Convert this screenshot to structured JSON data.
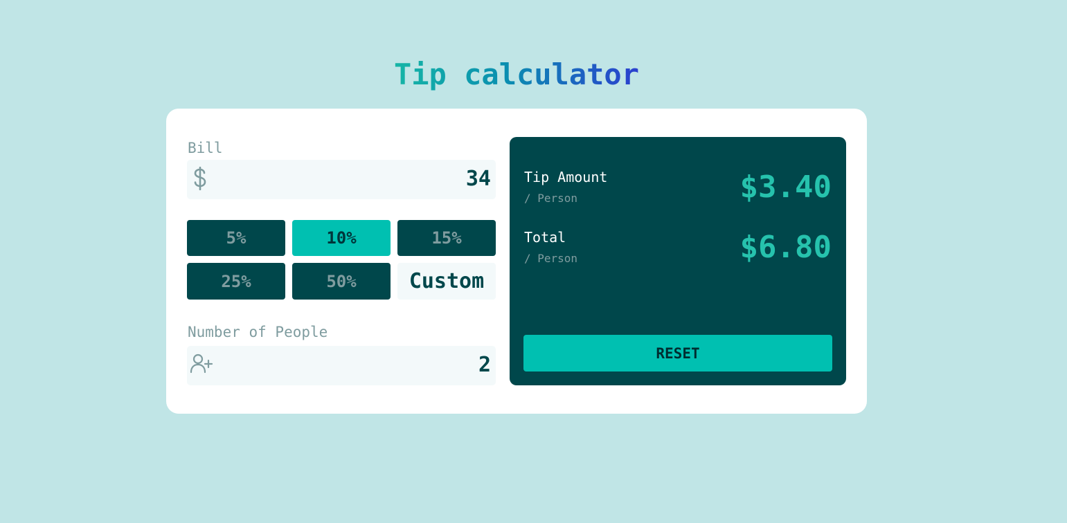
{
  "app": {
    "title": "Tip calculator"
  },
  "form": {
    "bill": {
      "label": "Bill",
      "value": "34",
      "icon": "dollar-icon"
    },
    "tips": {
      "options": [
        "5%",
        "10%",
        "15%",
        "25%",
        "50%"
      ],
      "selected": "10%",
      "custom_label": "Custom"
    },
    "people": {
      "label": "Number of People",
      "value": "2",
      "icon": "person-add-icon"
    }
  },
  "results": {
    "tip_amount_label": "Tip Amount",
    "tip_amount_sub": "/ Person",
    "tip_amount_value": "$3.40",
    "total_label": "Total",
    "total_sub": "/ Person",
    "total_value": "$6.80",
    "reset_label": "RESET"
  },
  "colors": {
    "background": "#c0e5e6",
    "dark_teal": "#00474b",
    "accent": "#00c0b1",
    "muted": "#7f9c9f"
  }
}
